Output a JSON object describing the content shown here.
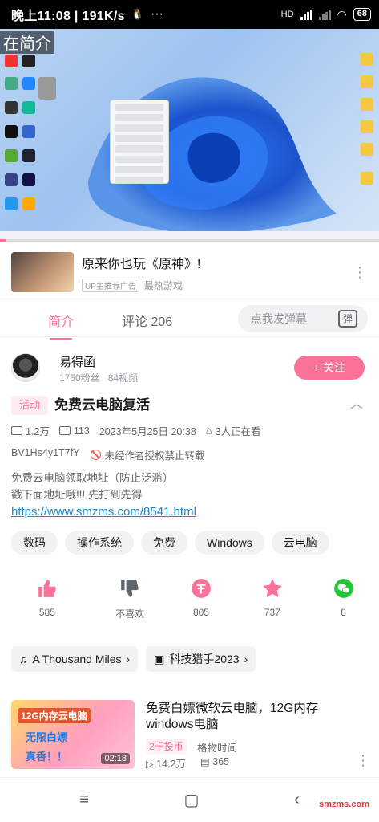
{
  "status_bar": {
    "time": "晚上11:08 | 191K/s",
    "battery": "68",
    "network": "HD"
  },
  "player": {
    "overlay_title": "在简介"
  },
  "ad": {
    "title": "原来你也玩《原神》!",
    "badge": "UP主推荐广告",
    "source": "最热游戏"
  },
  "tabs": {
    "intro": "简介",
    "comments": "评论 206",
    "danmaku_placeholder": "点我发弹幕",
    "danmaku_icon_text": "弹"
  },
  "uploader": {
    "name": "易得函",
    "fans": "1750粉丝",
    "videos": "84视频",
    "follow_label": "+ 关注"
  },
  "video": {
    "category_badge": "活动",
    "title": "免费云电脑复活",
    "plays": "1.2万",
    "danmaku_count": "113",
    "date": "2023年5月25日 20:38",
    "watching": "3人正在看",
    "bvid": "BV1Hs4y1T7fY",
    "copyright": "未经作者授权禁止转载",
    "desc_line1": "免费云电脑领取地址（防止泛滥）",
    "desc_line2": "戳下面地址哦!!! 先打到先得",
    "desc_link": "https://www.smzms.com/8541.html"
  },
  "tags": [
    "数码",
    "操作系统",
    "免费",
    "Windows",
    "云电脑"
  ],
  "actions": [
    {
      "icon": "thumbs-up-icon",
      "label": "585",
      "color": "#fb7299"
    },
    {
      "icon": "thumbs-down-icon",
      "label": "不喜欢",
      "color": "#61666d"
    },
    {
      "icon": "coin-icon",
      "label": "805",
      "color": "#fb7299"
    },
    {
      "icon": "star-icon",
      "label": "737",
      "color": "#fb7299"
    },
    {
      "icon": "wechat-icon",
      "label": "8",
      "color": "#24c63a"
    }
  ],
  "chips": {
    "music": "A Thousand Miles",
    "collection": "科技猎手2023"
  },
  "recommended": {
    "thumb_line1": "12G内存云电脑",
    "thumb_line2": "无限白嫖",
    "thumb_line3": "真香！！",
    "duration": "02:18",
    "title": "免费白嫖微软云电脑，12G内存windows电脑",
    "coin_badge": "2千投币",
    "author": "格物时间",
    "plays": "14.2万",
    "danmaku": "365"
  },
  "watermark": "smzms.com",
  "colors": {
    "accent": "#fb7299",
    "link": "#178bcf"
  }
}
